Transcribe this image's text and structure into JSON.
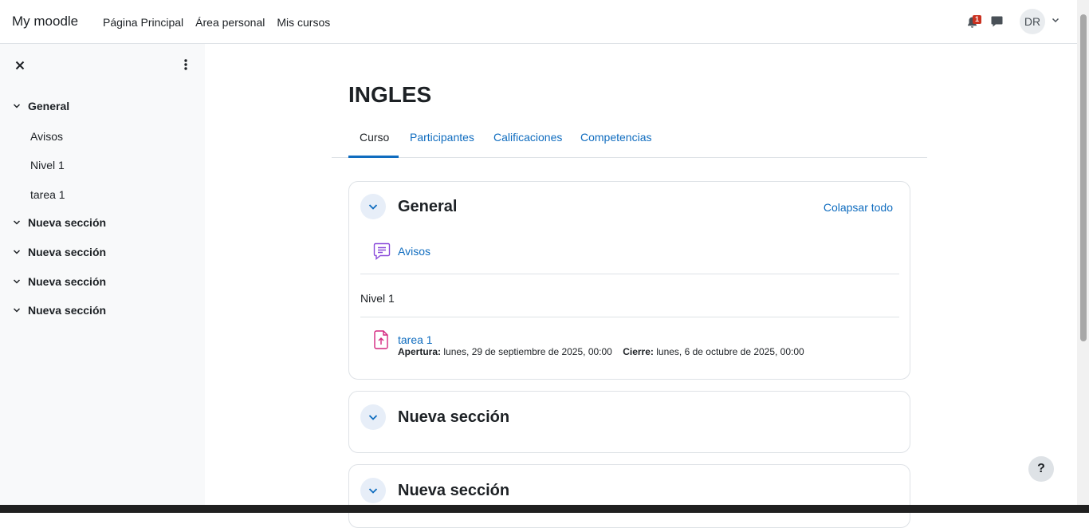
{
  "navbar": {
    "brand": "My moodle",
    "links": [
      "Página Principal",
      "Área personal",
      "Mis cursos"
    ],
    "notification_count": "1",
    "avatar_initials": "DR"
  },
  "drawer": {
    "sections": [
      {
        "label": "General",
        "items": [
          "Avisos",
          "Nivel 1",
          "tarea 1"
        ]
      },
      {
        "label": "Nueva sección",
        "items": []
      },
      {
        "label": "Nueva sección",
        "items": []
      },
      {
        "label": "Nueva sección",
        "items": []
      },
      {
        "label": "Nueva sección",
        "items": []
      }
    ]
  },
  "course": {
    "title": "INGLES",
    "tabs": [
      "Curso",
      "Participantes",
      "Calificaciones",
      "Competencias"
    ],
    "active_tab": "Curso",
    "collapse_all": "Colapsar todo",
    "sections": [
      {
        "title": "General",
        "activities": {
          "forum": {
            "name": "Avisos",
            "icon": "forum-icon"
          },
          "label": "Nivel 1",
          "assignment": {
            "name": "tarea 1",
            "icon": "assignment-icon",
            "open_label": "Apertura:",
            "open_value": "lunes, 29 de septiembre de 2025, 00:00",
            "close_label": "Cierre:",
            "close_value": "lunes, 6 de octubre de 2025, 00:00"
          }
        }
      },
      {
        "title": "Nueva sección"
      },
      {
        "title": "Nueva sección"
      }
    ]
  },
  "help": "?",
  "colors": {
    "link": "#0f6cbf",
    "drawer_bg": "#f8f9fa",
    "forum_icon": "#8a4bda",
    "assignment_icon": "#d4277f",
    "badge": "#ca3120"
  }
}
